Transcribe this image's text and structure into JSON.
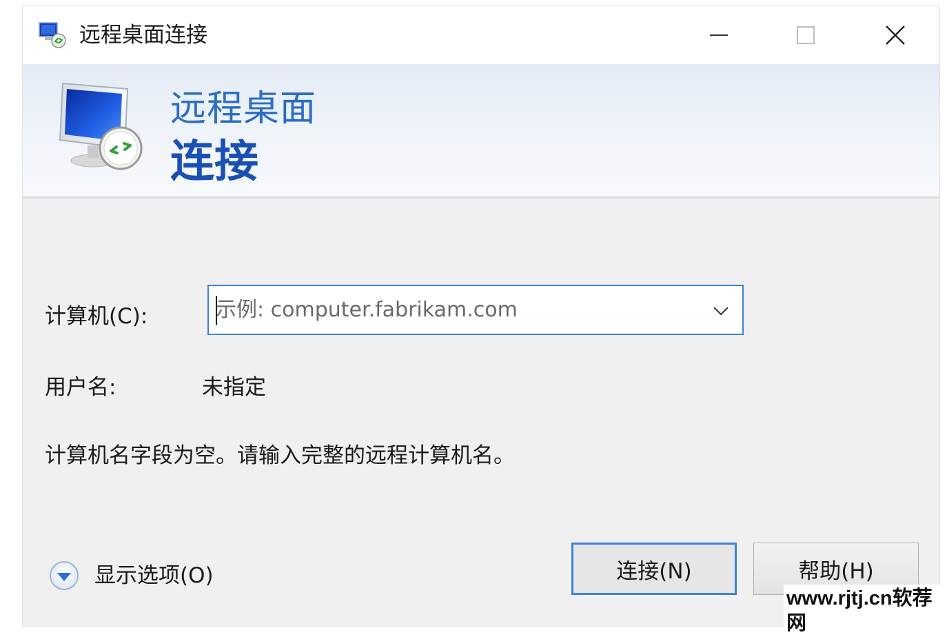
{
  "window": {
    "title": "远程桌面连接"
  },
  "banner": {
    "line1": "远程桌面",
    "line2": "连接"
  },
  "form": {
    "computer_label": "计算机(C):",
    "computer_placeholder": "示例: computer.fabrikam.com",
    "computer_value": "",
    "username_label": "用户名:",
    "username_value": "未指定",
    "message": "计算机名字段为空。请输入完整的远程计算机名。"
  },
  "footer": {
    "show_options_label": "显示选项(O)",
    "connect_label": "连接(N)",
    "help_label": "帮助(H)"
  },
  "watermark": "www.rjtj.cn软荐网",
  "colors": {
    "accent": "#3c82d8",
    "banner_title": "#2b6cc4",
    "banner_subtitle": "#1a4fb4"
  },
  "icons": {
    "app": "remote-desktop-icon",
    "minimize": "minimize-icon",
    "maximize": "maximize-icon",
    "close": "close-icon",
    "dropdown": "chevron-down-icon",
    "options": "expand-circle-icon"
  }
}
